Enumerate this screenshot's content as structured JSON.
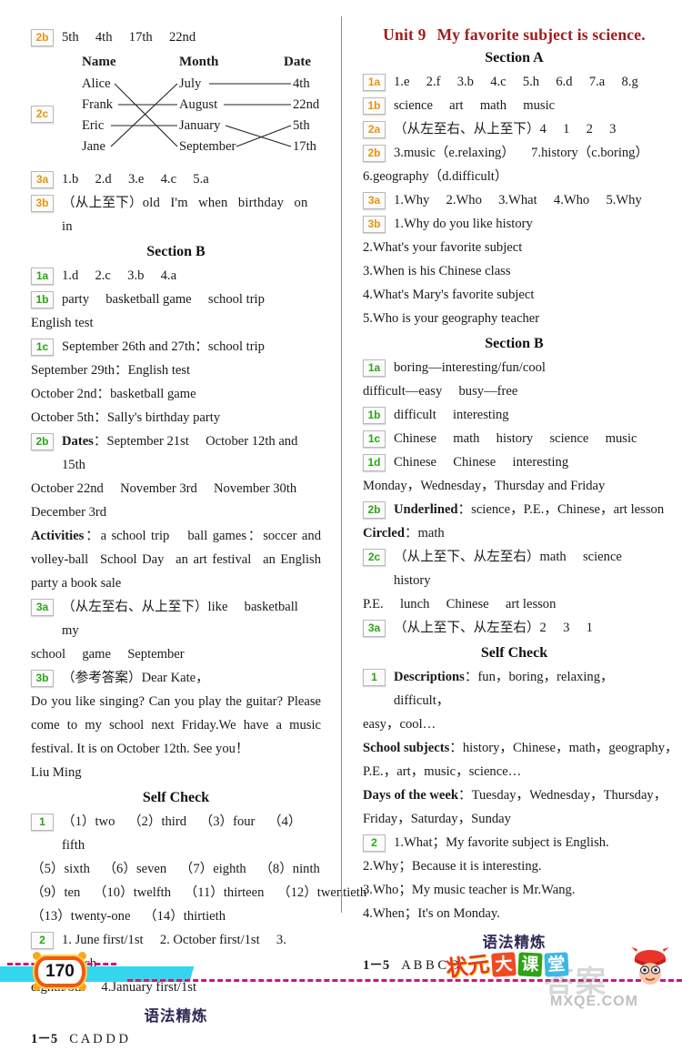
{
  "page": {
    "number": "170",
    "brand_cn": "状元",
    "brand_blocks": [
      "大",
      "课",
      "堂"
    ],
    "watermark": "答案",
    "watermark_url": "MXQE.COM",
    "colors": {
      "badge_orange": "#e6950d",
      "badge_green": "#2fa318",
      "unit_title_red": "#9e1b1b",
      "grammar_head": "#2f2a55",
      "ribbon_cyan": "#35d5ee",
      "dots_magenta": "#c51b7a",
      "page_badge_orange": "#f05a12"
    }
  },
  "left": {
    "item_2b": {
      "badge": "2b",
      "text": "5th  4th  17th  22nd"
    },
    "match": {
      "badge": "2c",
      "headers": [
        "Name",
        "Month",
        "Date"
      ],
      "names": [
        "Alice",
        "Frank",
        "Eric",
        "Jane"
      ],
      "months": [
        "July",
        "August",
        "January",
        "September"
      ],
      "dates": [
        "4th",
        "22nd",
        "5th",
        "17th"
      ],
      "name_to_month": [
        {
          "name": "Alice",
          "month": "September"
        },
        {
          "name": "Frank",
          "month": "August"
        },
        {
          "name": "Eric",
          "month": "January"
        },
        {
          "name": "Jane",
          "month": "July"
        }
      ],
      "month_to_date": [
        {
          "month": "July",
          "date": "4th"
        },
        {
          "month": "August",
          "date": "22nd"
        },
        {
          "month": "January",
          "date": "17th"
        },
        {
          "month": "September",
          "date": "5th"
        }
      ]
    },
    "item_3a": {
      "badge": "3a",
      "text": "1.b  2.d  3.e  4.c  5.a"
    },
    "item_3b": {
      "badge": "3b",
      "text": "（从上至下）old  I'm  when  birthday  on  in"
    },
    "section_b_head": "Section B",
    "sb_1a": {
      "badge": "1a",
      "text": "1.d  2.c  3.b  4.a"
    },
    "sb_1b": {
      "badge": "1b",
      "text": "party  basketball game  school trip"
    },
    "sb_1b_cont": "English test",
    "sb_1c": {
      "badge": "1c",
      "text": "September 26th and 27th：school trip"
    },
    "sb_1c_lines": [
      "September 29th：English test",
      "October 2nd：basketball game",
      "October 5th：Sally's birthday party"
    ],
    "sb_2b": {
      "badge": "2b",
      "label": "Dates",
      "text": "：September 21st  October 12th and 15th"
    },
    "sb_2b_lines": [
      "October 22nd  November 3rd  November 30th",
      "December 3rd"
    ],
    "sb_2b_activities_label": "Activities",
    "sb_2b_activities": "：a school trip  ball games：soccer and volley-ball  School Day  an art festival  an English party a book sale",
    "sb_3a": {
      "badge": "3a",
      "text": "（从左至右、从上至下）like  basketball  my"
    },
    "sb_3a_cont": "school  game  September",
    "sb_3b": {
      "badge": "3b",
      "text": "（参考答案）Dear Kate，"
    },
    "sb_3b_body": "Do you like singing? Can you play the guitar? Please come to my school next Friday.We have a music festival. It is on October 12th. See you！",
    "sb_3b_sign": "Liu Ming",
    "self_check_head": "Self Check",
    "sc_1": {
      "badge": "1",
      "text": "（1）two （2）third （3）four （4）fifth"
    },
    "sc_1_lines": [
      "（5）sixth （6）seven （7）eighth （8）ninth",
      "（9）ten （10）twelfth （11）thirteen （12）twentieth",
      "（13）twenty-one （14）thirtieth"
    ],
    "sc_2": {
      "badge": "2",
      "text": "1. June first/1st  2. October first/1st  3. March"
    },
    "sc_2_cont": "eighth/8th  4.January first/1st",
    "grammar_head": "语法精炼",
    "grammar_answers": {
      "range": "1－5",
      "values": "C A D D D"
    }
  },
  "right": {
    "unit_label": "Unit 9",
    "unit_title": "My favorite subject is science.",
    "section_a_head": "Section A",
    "sa_1a": {
      "badge": "1a",
      "text": "1.e  2.f  3.b  4.c  5.h  6.d  7.a  8.g"
    },
    "sa_1b": {
      "badge": "1b",
      "text": "science  art  math  music"
    },
    "sa_2a": {
      "badge": "2a",
      "text": "（从左至右、从上至下）4  1  2  3"
    },
    "sa_2b": {
      "badge": "2b",
      "text": "3.music（e.relaxing）  7.history（c.boring）"
    },
    "sa_2b_cont": "6.geography（d.difficult）",
    "sa_3a": {
      "badge": "3a",
      "text": "1.Why  2.Who  3.What  4.Who  5.Why"
    },
    "sa_3b": {
      "badge": "3b",
      "text": "1.Why do you like history"
    },
    "sa_3b_lines": [
      "2.What's your favorite subject",
      "3.When is his Chinese class",
      "4.What's Mary's favorite subject",
      "5.Who is your geography teacher"
    ],
    "section_b_head": "Section B",
    "sb_1a": {
      "badge": "1a",
      "text": "boring—interesting/fun/cool"
    },
    "sb_1a_cont": "difficult—easy  busy—free",
    "sb_1b": {
      "badge": "1b",
      "text": "difficult  interesting"
    },
    "sb_1c": {
      "badge": "1c",
      "text": "Chinese  math  history  science  music"
    },
    "sb_1d": {
      "badge": "1d",
      "text": "Chinese  Chinese  interesting"
    },
    "sb_1d_cont": "Monday，Wednesday，Thursday and Friday",
    "sb_2b": {
      "badge": "2b",
      "label": "Underlined",
      "text": "：science，P.E.，Chinese，art lesson"
    },
    "sb_2b_circled_label": "Circled",
    "sb_2b_circled": "：math",
    "sb_2c": {
      "badge": "2c",
      "text": "（从上至下、从左至右）math  science  history"
    },
    "sb_2c_cont": "P.E.  lunch  Chinese  art lesson",
    "sb_3a": {
      "badge": "3a",
      "text": "（从上至下、从左至右）2  3  1"
    },
    "self_check_head": "Self Check",
    "sc_1": {
      "badge": "1",
      "label": "Descriptions",
      "text": "：fun，boring，relaxing，difficult，"
    },
    "sc_1_cont": "easy，cool…",
    "sc_1_subjects_label": "School subjects",
    "sc_1_subjects": "：history，Chinese，math，geography，",
    "sc_1_subjects_cont": "P.E.，art，music，science…",
    "sc_1_days_label": "Days of the week",
    "sc_1_days": "：Tuesday，Wednesday，Thursday，",
    "sc_1_days_cont": "Friday，Saturday，Sunday",
    "sc_2": {
      "badge": "2",
      "text": "1.What；My favorite subject is English."
    },
    "sc_2_lines": [
      "2.Why；Because it is interesting.",
      "3.Who；My music teacher is Mr.Wang.",
      "4.When；It's on Monday."
    ],
    "grammar_head": "语法精炼",
    "grammar_answers": {
      "range": "1－5",
      "values": "A B B C D"
    }
  }
}
